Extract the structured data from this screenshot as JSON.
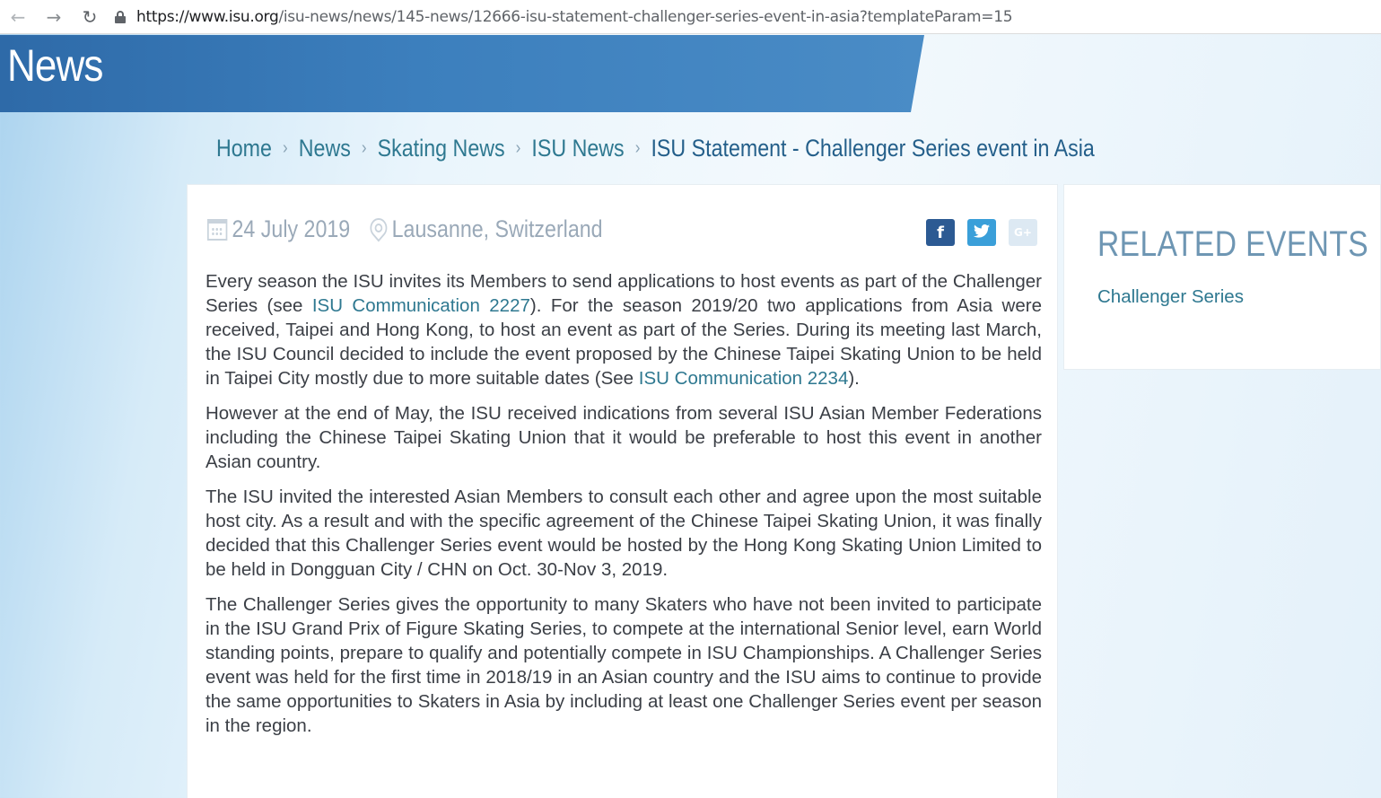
{
  "browser": {
    "url_host": "https://www.isu.org",
    "url_path": "/isu-news/news/145-news/12666-isu-statement-challenger-series-event-in-asia?templateParam=15"
  },
  "banner": {
    "title": "News"
  },
  "breadcrumb": {
    "items": [
      "Home",
      "News",
      "Skating News",
      "ISU News",
      "ISU Statement - Challenger Series event in Asia"
    ],
    "separator": "›"
  },
  "article": {
    "date": "24 July 2019",
    "location": "Lausanne, Switzerland",
    "share": {
      "facebook": "f",
      "twitter": "t",
      "googleplus": "G+"
    },
    "p1": {
      "t1": "Every season the ISU invites its Members to send applications to host events as part of the Challenger Series (see ",
      "link1": "ISU Communication 2227",
      "t2": "). For the season 2019/20 two applications from Asia were received, Taipei and Hong Kong, to host an event as part of the Series. During its meeting last March, the ISU Council decided to include the event proposed by the Chinese Taipei Skating Union to be held in Taipei City mostly due to more suitable dates (See ",
      "link2": "ISU Communication 2234",
      "t3": ")."
    },
    "p2": "However at the end of May, the ISU received indications from several ISU Asian Member Federations including the Chinese Taipei Skating Union that it would be preferable to host this event in another Asian country.",
    "p3": "The ISU invited the interested Asian Members to consult each other and agree upon the most suitable host city. As a result and with the specific agreement of the Chinese Taipei Skating Union, it was finally decided that this Challenger Series event would be hosted by the Hong Kong Skating Union Limited to be held in Dongguan City / CHN on Oct. 30-Nov 3, 2019.",
    "p4": "The Challenger Series gives the opportunity to many Skaters who have not been invited to participate in the ISU Grand Prix of Figure Skating Series, to compete at the international Senior level, earn World standing points, prepare to qualify and potentially compete in ISU Championships. A Challenger Series event was held for the first time in 2018/19 in an Asian country and the ISU aims to continue to provide the same opportunities to Skaters in Asia by including at least one Challenger Series event per season in the region."
  },
  "sidebar": {
    "title": "RELATED EVENTS",
    "link": "Challenger Series"
  },
  "colors": {
    "banner": "#3c7fbd",
    "link": "#2e7890",
    "facebook": "#2c5a93",
    "twitter": "#3a9fd9"
  }
}
